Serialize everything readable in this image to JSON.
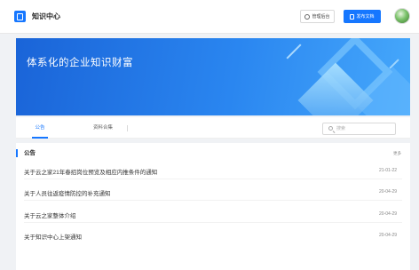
{
  "header": {
    "title": "知识中心",
    "admin_label": "管理后台",
    "publish_label": "发布文档"
  },
  "banner": {
    "title": "体系化的企业知识财富"
  },
  "tabs": [
    {
      "label": "公告",
      "active": true
    },
    {
      "label": "资料合集",
      "active": false
    }
  ],
  "search": {
    "placeholder": "搜索"
  },
  "notices": {
    "title": "公告",
    "more_label": "更多",
    "items": [
      {
        "text": "关于云之家21年春招岗位预览及相应内推条件的通知",
        "date": "21-01-22"
      },
      {
        "text": "关于人员往返疫情防控的补充通知",
        "date": "20-04-29"
      },
      {
        "text": "关于云之家整体介绍",
        "date": "20-04-29"
      },
      {
        "text": "关于知识中心上架通知",
        "date": "20-04-29"
      }
    ]
  },
  "colors": {
    "accent": "#1677ff",
    "banner_start": "#1a64d8",
    "banner_end": "#46a8fb"
  }
}
